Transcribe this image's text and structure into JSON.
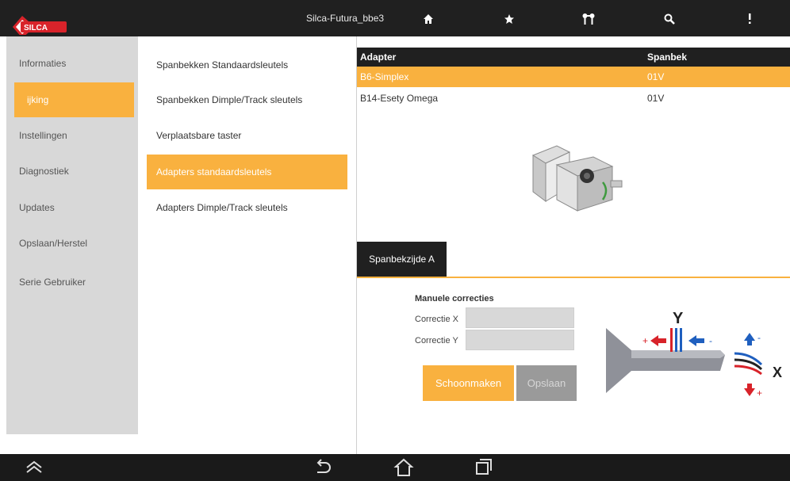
{
  "app": {
    "title": "Silca-Futura_bbe3",
    "logo_text": "SILCA",
    "accent": "#f9b13f",
    "bar_color": "#202020"
  },
  "topbar_icons": [
    {
      "icon": "home-icon"
    },
    {
      "icon": "star-icon"
    },
    {
      "icon": "key-icon"
    },
    {
      "icon": "search-icon"
    },
    {
      "icon": "overflow-menu-icon"
    }
  ],
  "sidebar": {
    "items": [
      {
        "label": "Informaties"
      },
      {
        "label": "ijking"
      },
      {
        "label": "Instellingen"
      },
      {
        "label": "Diagnostiek"
      },
      {
        "label": "Updates"
      },
      {
        "label": "Opslaan/Herstel"
      },
      {
        "label": "Serie Gebruiker"
      }
    ],
    "active": "ijking"
  },
  "menu": {
    "items": [
      {
        "label": "Spanbekken Standaardsleutels"
      },
      {
        "label": "Spanbekken Dimple/Track sleutels"
      },
      {
        "label": "Verplaatsbare taster"
      },
      {
        "label": "Adapters standaardsleutels"
      },
      {
        "label": "Adapters Dimple/Track sleutels"
      }
    ],
    "active": "Adapters standaardsleutels"
  },
  "table": {
    "headers": [
      "Adapter",
      "Spanbek"
    ],
    "rows": [
      {
        "adapter": "B6-Simplex",
        "spanbek": "01V",
        "selected": true
      },
      {
        "adapter": "B14-Esety Omega",
        "spanbek": "01V",
        "selected": false
      }
    ]
  },
  "tab": {
    "label": "Spanbekzijde A"
  },
  "corrections": {
    "title": "Manuele correcties",
    "x_label": "Correctie X",
    "y_label": "Correctie Y",
    "x_value": "",
    "y_value": ""
  },
  "buttons": {
    "clean": "Schoonmaken",
    "save": "Opslaan"
  },
  "diagram": {
    "y_label": "Y",
    "x_label": "X"
  },
  "navbar_icons": [
    {
      "icon": "collapse-icon"
    },
    {
      "icon": "back-icon"
    },
    {
      "icon": "home-icon"
    },
    {
      "icon": "recent-apps-icon"
    }
  ]
}
